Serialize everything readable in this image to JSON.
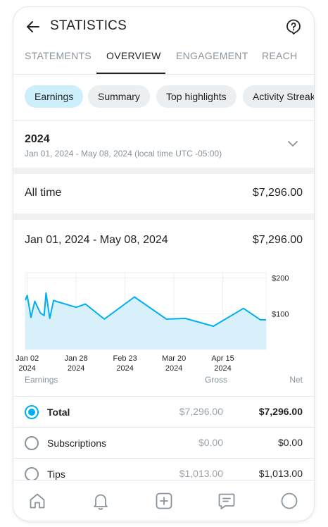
{
  "header": {
    "title": "STATISTICS"
  },
  "tabs": [
    {
      "label": "STATEMENTS",
      "active": false
    },
    {
      "label": "OVERVIEW",
      "active": true
    },
    {
      "label": "ENGAGEMENT",
      "active": false
    },
    {
      "label": "REACH",
      "active": false
    }
  ],
  "chips": [
    {
      "label": "Earnings",
      "active": true
    },
    {
      "label": "Summary",
      "active": false
    },
    {
      "label": "Top highlights",
      "active": false
    },
    {
      "label": "Activity Streak",
      "active": false
    }
  ],
  "period": {
    "year": "2024",
    "range": "Jan 01, 2024 - May 08, 2024 (local time UTC -05:00)"
  },
  "all_time": {
    "label": "All time",
    "value": "$7,296.00"
  },
  "summary": {
    "range_label": "Jan 01, 2024 - May 08, 2024",
    "total": "$7,296.00"
  },
  "chart_data": {
    "type": "area",
    "color": "#00aff0",
    "x_tick_labels": [
      {
        "top": "Jan 02",
        "bottom": "2024"
      },
      {
        "top": "Jan 28",
        "bottom": "2024"
      },
      {
        "top": "Feb 23",
        "bottom": "2024"
      },
      {
        "top": "Mar 20",
        "bottom": "2024"
      },
      {
        "top": "Apr 15",
        "bottom": "2024"
      }
    ],
    "y_tick_labels": [
      "$200",
      "$100"
    ],
    "y_ticks": [
      200,
      100
    ],
    "ylim": [
      0,
      215
    ],
    "xlim": [
      "2024-01-01",
      "2024-05-08"
    ],
    "x": [
      "2024-01-01",
      "2024-01-02",
      "2024-01-04",
      "2024-01-06",
      "2024-01-09",
      "2024-01-11",
      "2024-01-12",
      "2024-01-14",
      "2024-01-16",
      "2024-01-28",
      "2024-02-02",
      "2024-02-12",
      "2024-02-28",
      "2024-03-16",
      "2024-03-26",
      "2024-04-10",
      "2024-04-26",
      "2024-05-05",
      "2024-05-08"
    ],
    "values": [
      138,
      151,
      90,
      135,
      102,
      95,
      158,
      87,
      137,
      118,
      127,
      85,
      147,
      85,
      87,
      65,
      115,
      83,
      83
    ]
  },
  "earnings_table": {
    "headers": {
      "earnings": "Earnings",
      "gross": "Gross",
      "net": "Net"
    },
    "rows": [
      {
        "label": "Total",
        "gross": "$7,296.00",
        "net": "$7,296.00",
        "selected": true
      },
      {
        "label": "Subscriptions",
        "gross": "$0.00",
        "net": "$0.00",
        "selected": false
      },
      {
        "label": "Tips",
        "gross": "$1,013.00",
        "net": "$1,013.00",
        "selected": false
      }
    ]
  },
  "icons": {
    "back": "arrow-left-icon",
    "help": "question-circle-icon",
    "chevron": "chevron-down-icon",
    "nav": [
      "home-icon",
      "bell-icon",
      "plus-square-icon",
      "message-icon",
      "profile-circle-icon"
    ]
  }
}
